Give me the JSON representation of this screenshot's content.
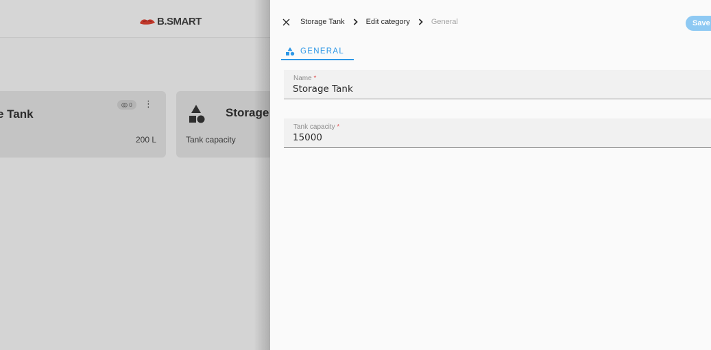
{
  "background": {
    "logo_text": "B.SMART",
    "card_1": {
      "title": "e Tank",
      "meta": "200 L",
      "badge_count": "0"
    },
    "card_2": {
      "title": "Storage",
      "meta": "Tank capacity"
    }
  },
  "panel": {
    "breadcrumb": [
      "Storage Tank",
      "Edit category",
      "General"
    ],
    "save_label": "Save",
    "tab_label": "GENERAL",
    "fields": [
      {
        "label": "Name",
        "required_mark": "*",
        "value": "Storage Tank"
      },
      {
        "label": "Tank capacity",
        "required_mark": "*",
        "value": "15000"
      }
    ]
  },
  "colors": {
    "accent": "#2d97e6",
    "save_button": "#8ec9f3",
    "required": "#e05a5a",
    "logo_red": "#e03131"
  }
}
